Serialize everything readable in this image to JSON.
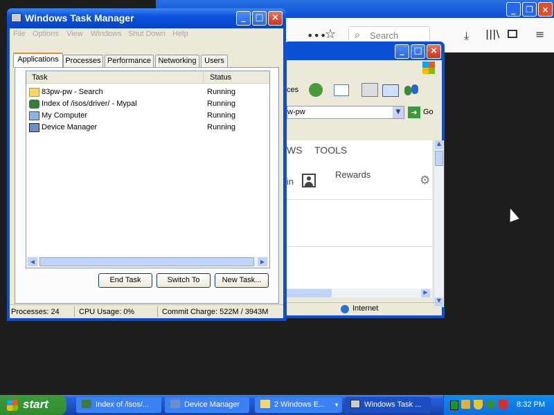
{
  "firefox": {
    "search_placeholder": "Search"
  },
  "ie": {
    "toolbar_partial": "ces",
    "address_partial": "w-pw",
    "go_label": "Go",
    "nav_partial": "WS",
    "nav_tools": "TOOLS",
    "signin_partial": "in",
    "rewards": "Rewards",
    "status_zone": "Internet"
  },
  "taskmgr": {
    "title": "Windows Task Manager",
    "menu": [
      "File",
      "Options",
      "View",
      "Windows",
      "Shut Down",
      "Help"
    ],
    "tabs": [
      "Applications",
      "Processes",
      "Performance",
      "Networking",
      "Users"
    ],
    "columns": {
      "task": "Task",
      "status": "Status"
    },
    "rows": [
      {
        "name": "83pw-pw - Search",
        "status": "Running",
        "icon": "folder-icon"
      },
      {
        "name": "Index of /isos/driver/ - Mypal",
        "status": "Running",
        "icon": "mypal-icon"
      },
      {
        "name": "My Computer",
        "status": "Running",
        "icon": "my-computer-icon"
      },
      {
        "name": "Device Manager",
        "status": "Running",
        "icon": "device-manager-icon"
      }
    ],
    "buttons": {
      "end": "End Task",
      "switch": "Switch To",
      "new": "New Task..."
    },
    "status": {
      "processes": "Processes: 24",
      "cpu": "CPU Usage: 0%",
      "commit": "Commit Charge: 522M / 3943M"
    }
  },
  "taskbar": {
    "start": "start",
    "items": [
      "Index of /isos/...",
      "Device Manager",
      "2 Windows E...",
      "Windows Task ..."
    ],
    "clock": "8:32 PM"
  }
}
